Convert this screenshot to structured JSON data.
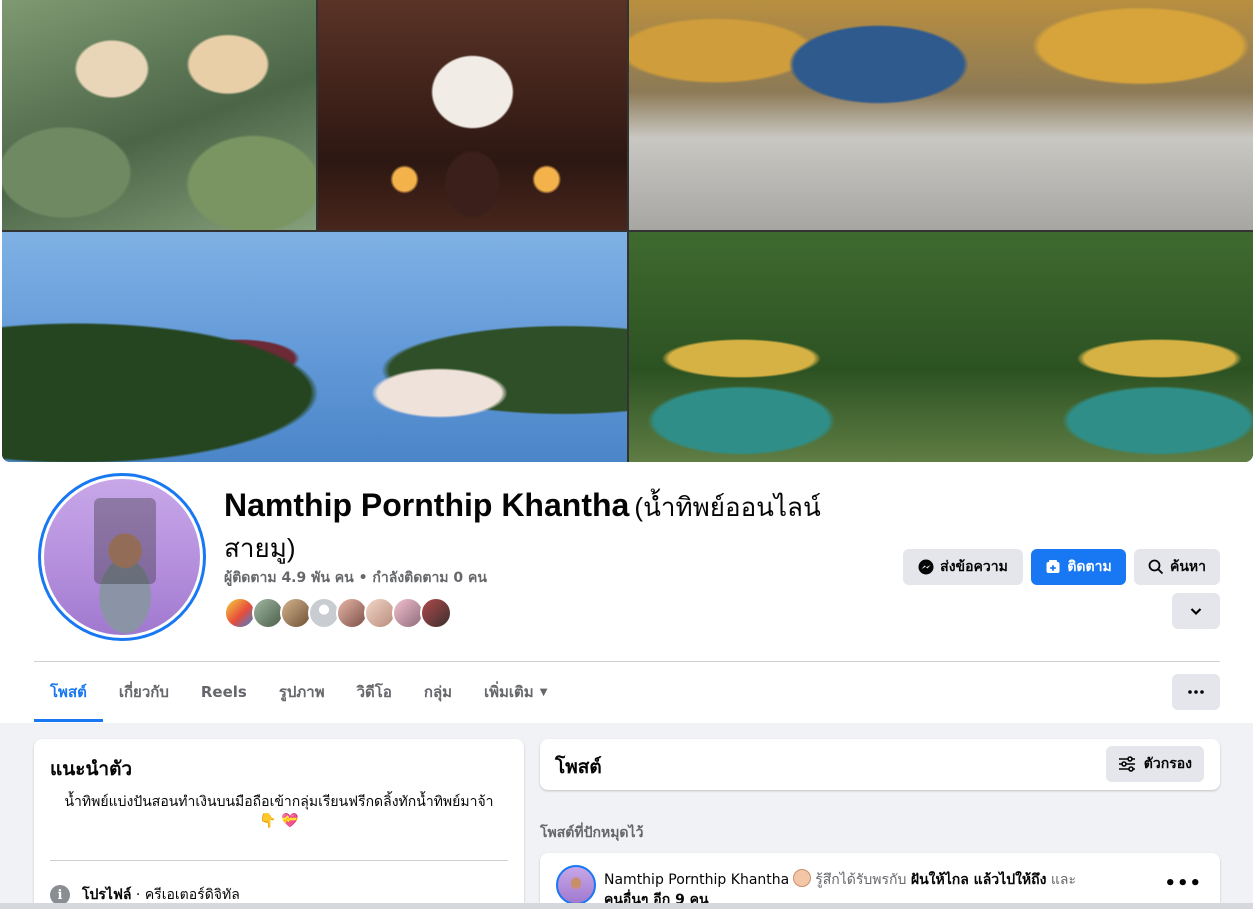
{
  "profile": {
    "name": "Namthip Pornthip Khantha",
    "alt_name_line1": "(น้ำทิพย์ออนไลน์",
    "alt_name_line2": "สายมู)",
    "followers": "ผู้ติดตาม 4.9 พัน คน • กำลังติดตาม 0 คน"
  },
  "actions": {
    "message": "ส่งข้อความ",
    "follow": "ติดตาม",
    "search": "ค้นหา"
  },
  "tabs": [
    {
      "label": "โพสต์",
      "active": true
    },
    {
      "label": "เกี่ยวกับ"
    },
    {
      "label": "Reels"
    },
    {
      "label": "รูปภาพ"
    },
    {
      "label": "วิดีโอ"
    },
    {
      "label": "กลุ่ม"
    },
    {
      "label": "เพิ่มเติม"
    }
  ],
  "intro": {
    "title": "แนะนำตัว",
    "bio": "น้ำทิพย์แบ่งปันสอนทำเงินบนมือถือเข้ากลุ่มเรียนฟรีกดลิ้งทักน้ำทิพย์มาจ้า",
    "bio_emoji": "👇 💝",
    "profile_label": "โปรไฟล์",
    "profile_value": " · ครีเอเตอร์ดิจิทัล"
  },
  "posts": {
    "title": "โพสต์",
    "filter_label": "ตัวกรอง",
    "pinned_label": "โพสต์ที่ปักหมุดไว้",
    "pinned_post": {
      "author": "Namthip Pornthip Khantha",
      "feeling": "รู้สึกได้รับพรกับ",
      "with_name": "ฝันให้ไกล แล้วไปให้ถึง",
      "and": "และ",
      "others": "คนอื่นๆ อีก 9 คน"
    }
  },
  "colors": {
    "accent": "#1877f2",
    "page_bg": "#f0f2f5",
    "button_gray": "#e4e6eb",
    "text_secondary": "#65676b"
  },
  "icons": [
    "messenger-icon",
    "follow-icon",
    "search-icon",
    "chevron-down-icon",
    "more-icon",
    "filter-icon",
    "info-icon",
    "caret-down-icon"
  ]
}
